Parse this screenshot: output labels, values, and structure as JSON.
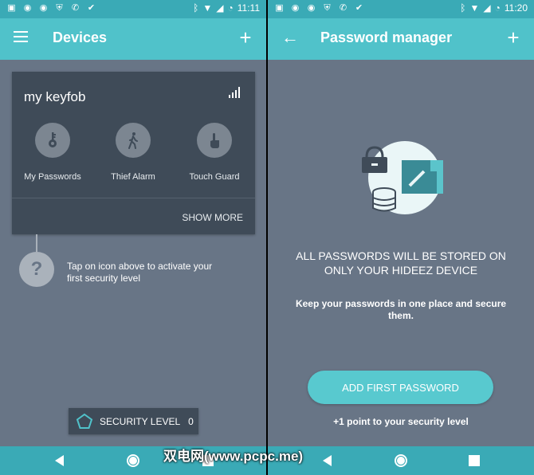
{
  "left": {
    "status": {
      "time": "11:11"
    },
    "appbar": {
      "title": "Devices"
    },
    "device": {
      "name": "my keyfob",
      "features": [
        {
          "label": "My Passwords",
          "icon": "key-icon"
        },
        {
          "label": "Thief Alarm",
          "icon": "walking-person-icon"
        },
        {
          "label": "Touch Guard",
          "icon": "touch-hand-icon"
        }
      ],
      "show_more": "SHOW MORE"
    },
    "hint": {
      "icon_text": "?",
      "text": "Tap on icon above to activate your first security level"
    },
    "security": {
      "label": "SECURITY LEVEL",
      "value": "0"
    }
  },
  "right": {
    "status": {
      "time": "11:20"
    },
    "appbar": {
      "title": "Password manager"
    },
    "headline": "ALL PASSWORDS WILL BE STORED ON ONLY YOUR HIDEEZ DEVICE",
    "subtitle": "Keep your passwords in one place and secure them.",
    "add_button": "ADD FIRST PASSWORD",
    "point_note": "+1 point to your security level"
  },
  "watermark": "双电网(www.pcpc.me)",
  "colors": {
    "accent": "#50c2ca",
    "background": "#687586",
    "card": "#3f4b58"
  }
}
